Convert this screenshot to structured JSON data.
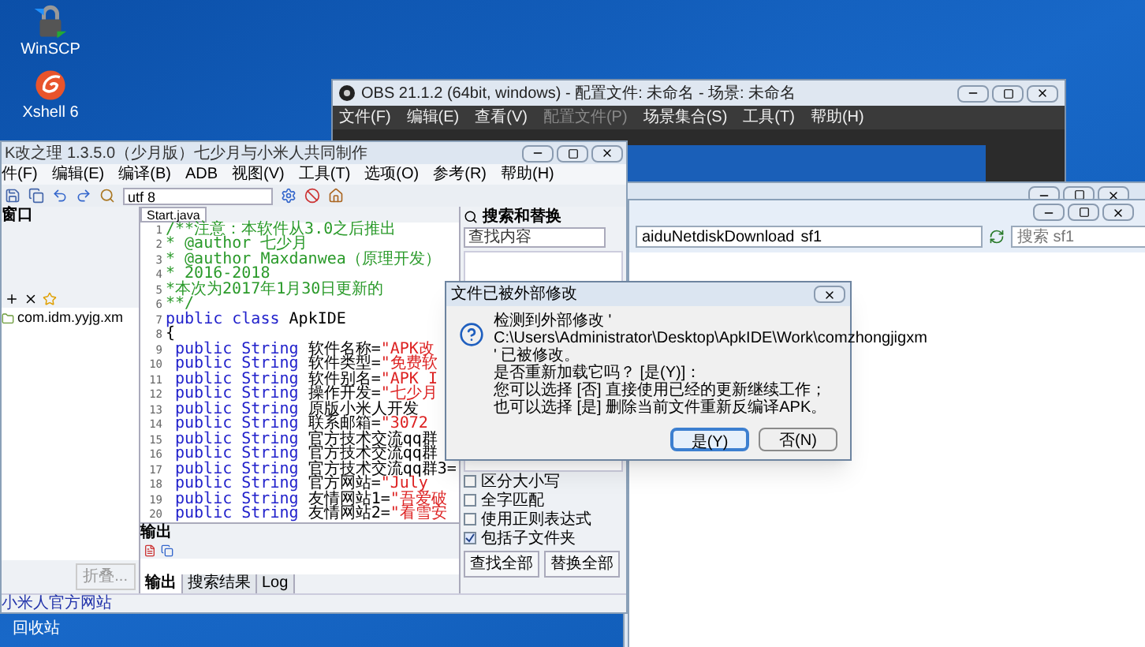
{
  "desktop_icons": [
    {
      "label": "WinSCP",
      "kind": "lock"
    },
    {
      "label": "Xshell 6",
      "kind": "shell"
    }
  ],
  "desktop_label": "回收站",
  "obs": {
    "title": "OBS 21.1.2 (64bit, windows) - 配置文件: 未命名 - 场景: 未命名",
    "menu": [
      {
        "label": "文件(F)",
        "disabled": false
      },
      {
        "label": "编辑(E)",
        "disabled": false
      },
      {
        "label": "查看(V)",
        "disabled": false
      },
      {
        "label": "配置文件(P)",
        "disabled": true
      },
      {
        "label": "场景集合(S)",
        "disabled": false
      },
      {
        "label": "工具(T)",
        "disabled": false
      },
      {
        "label": "帮助(H)",
        "disabled": false
      }
    ]
  },
  "explorer": {
    "path": "aiduNetdiskDownload",
    "folder": "sf1",
    "search": {
      "placeholder": "搜索 sf1"
    }
  },
  "ide": {
    "title": "K改之理 1.3.5.0（少月版）七少月与小米人共同制作",
    "menu": [
      "件(F)",
      "编辑(E)",
      "编译(B)",
      "ADB",
      "视图(V)",
      "工具(T)",
      "选项(O)",
      "参考(R)",
      "帮助(H)"
    ],
    "encoding": "utf 8",
    "side_panel": {
      "title": "窗口",
      "items": [
        "com.idm.yyjg.xm"
      ],
      "button": "折叠..."
    },
    "editor": {
      "tab": "Start.java",
      "lines": [
        {
          "number": "1",
          "kind": "comment",
          "text": "/**注意：本软件从3.0之后推出"
        },
        {
          "number": "2",
          "kind": "comment",
          "text": " * @author 七少月"
        },
        {
          "number": "3",
          "kind": "comment",
          "text": " * @author Maxdanwea（原理开发）"
        },
        {
          "number": "4",
          "kind": "comment",
          "text": " * 2016-2018"
        },
        {
          "number": "5",
          "kind": "comment",
          "text": " *本次为2017年1月30日更新的"
        },
        {
          "number": "6",
          "kind": "comment",
          "text": " **/"
        },
        {
          "number": "7",
          "kind": "decl",
          "keyword": "public class",
          "name": "ApkIDE"
        },
        {
          "number": "8",
          "kind": "plain",
          "text": "{"
        },
        {
          "number": "9",
          "kind": "field",
          "keyword": "public String",
          "name": "软件名称=",
          "value": "\"APK改"
        },
        {
          "number": "10",
          "kind": "field",
          "keyword": "public String",
          "name": "软件类型=",
          "value": "\"免费软"
        },
        {
          "number": "11",
          "kind": "field",
          "keyword": "public String",
          "name": "软件别名=",
          "value": "\"APK I"
        },
        {
          "number": "12",
          "kind": "field",
          "keyword": "public String",
          "name": "操作开发=",
          "value": "\"七少月"
        },
        {
          "number": "13",
          "kind": "field",
          "keyword": "public String",
          "name": "原版小米人开发"
        },
        {
          "number": "14",
          "kind": "field",
          "keyword": "public String",
          "name": "联系邮箱=",
          "value": "\"3072"
        },
        {
          "number": "15",
          "kind": "field",
          "keyword": "public String",
          "name": "官方技术交流qq群"
        },
        {
          "number": "16",
          "kind": "field",
          "keyword": "public String",
          "name": "官方技术交流qq群"
        },
        {
          "number": "17",
          "kind": "field",
          "keyword": "public String",
          "name": "官方技术交流qq群3="
        },
        {
          "number": "18",
          "kind": "field",
          "keyword": "public String",
          "name": "官方网站=",
          "value": "\"July"
        },
        {
          "number": "19",
          "kind": "field",
          "keyword": "public String",
          "name": "友情网站1=",
          "value": "\"吾爱破"
        },
        {
          "number": "20",
          "kind": "field",
          "keyword": "public String",
          "name": "友情网站2=",
          "value": "\"看雪安"
        }
      ]
    },
    "output": {
      "title": "输出",
      "tabs": [
        {
          "label": "输出",
          "selected": true
        },
        {
          "label": "搜索结果",
          "selected": false
        },
        {
          "label": "Log",
          "selected": false
        }
      ]
    },
    "search_panel": {
      "title": "搜索和替换",
      "find": {
        "placeholder": "查找内容"
      },
      "options": [
        {
          "label": "区分大小写",
          "checked": false
        },
        {
          "label": "全字匹配",
          "checked": false
        },
        {
          "label": "使用正则表达式",
          "checked": false
        },
        {
          "label": "包括子文件夹",
          "checked": true
        }
      ],
      "buttons": [
        "查找全部",
        "替换全部"
      ]
    },
    "status_bar": "小米人官方网站"
  },
  "dialog": {
    "title": "文件已被外部修改",
    "lines": [
      "检测到外部修改 '",
      "C:\\Users\\Administrator\\Desktop\\ApkIDE\\Work\\comzhongjigxm",
      "' 已被修改。",
      "是否重新加载它吗？ [是(Y)]：",
      "您可以选择 [否] 直接使用已经的更新继续工作；",
      "也可以选择 [是] 删除当前文件重新反编译APK。"
    ],
    "buttons": [
      {
        "label": "是(Y)",
        "selected": true
      },
      {
        "label": "否(N)",
        "selected": false
      }
    ]
  }
}
